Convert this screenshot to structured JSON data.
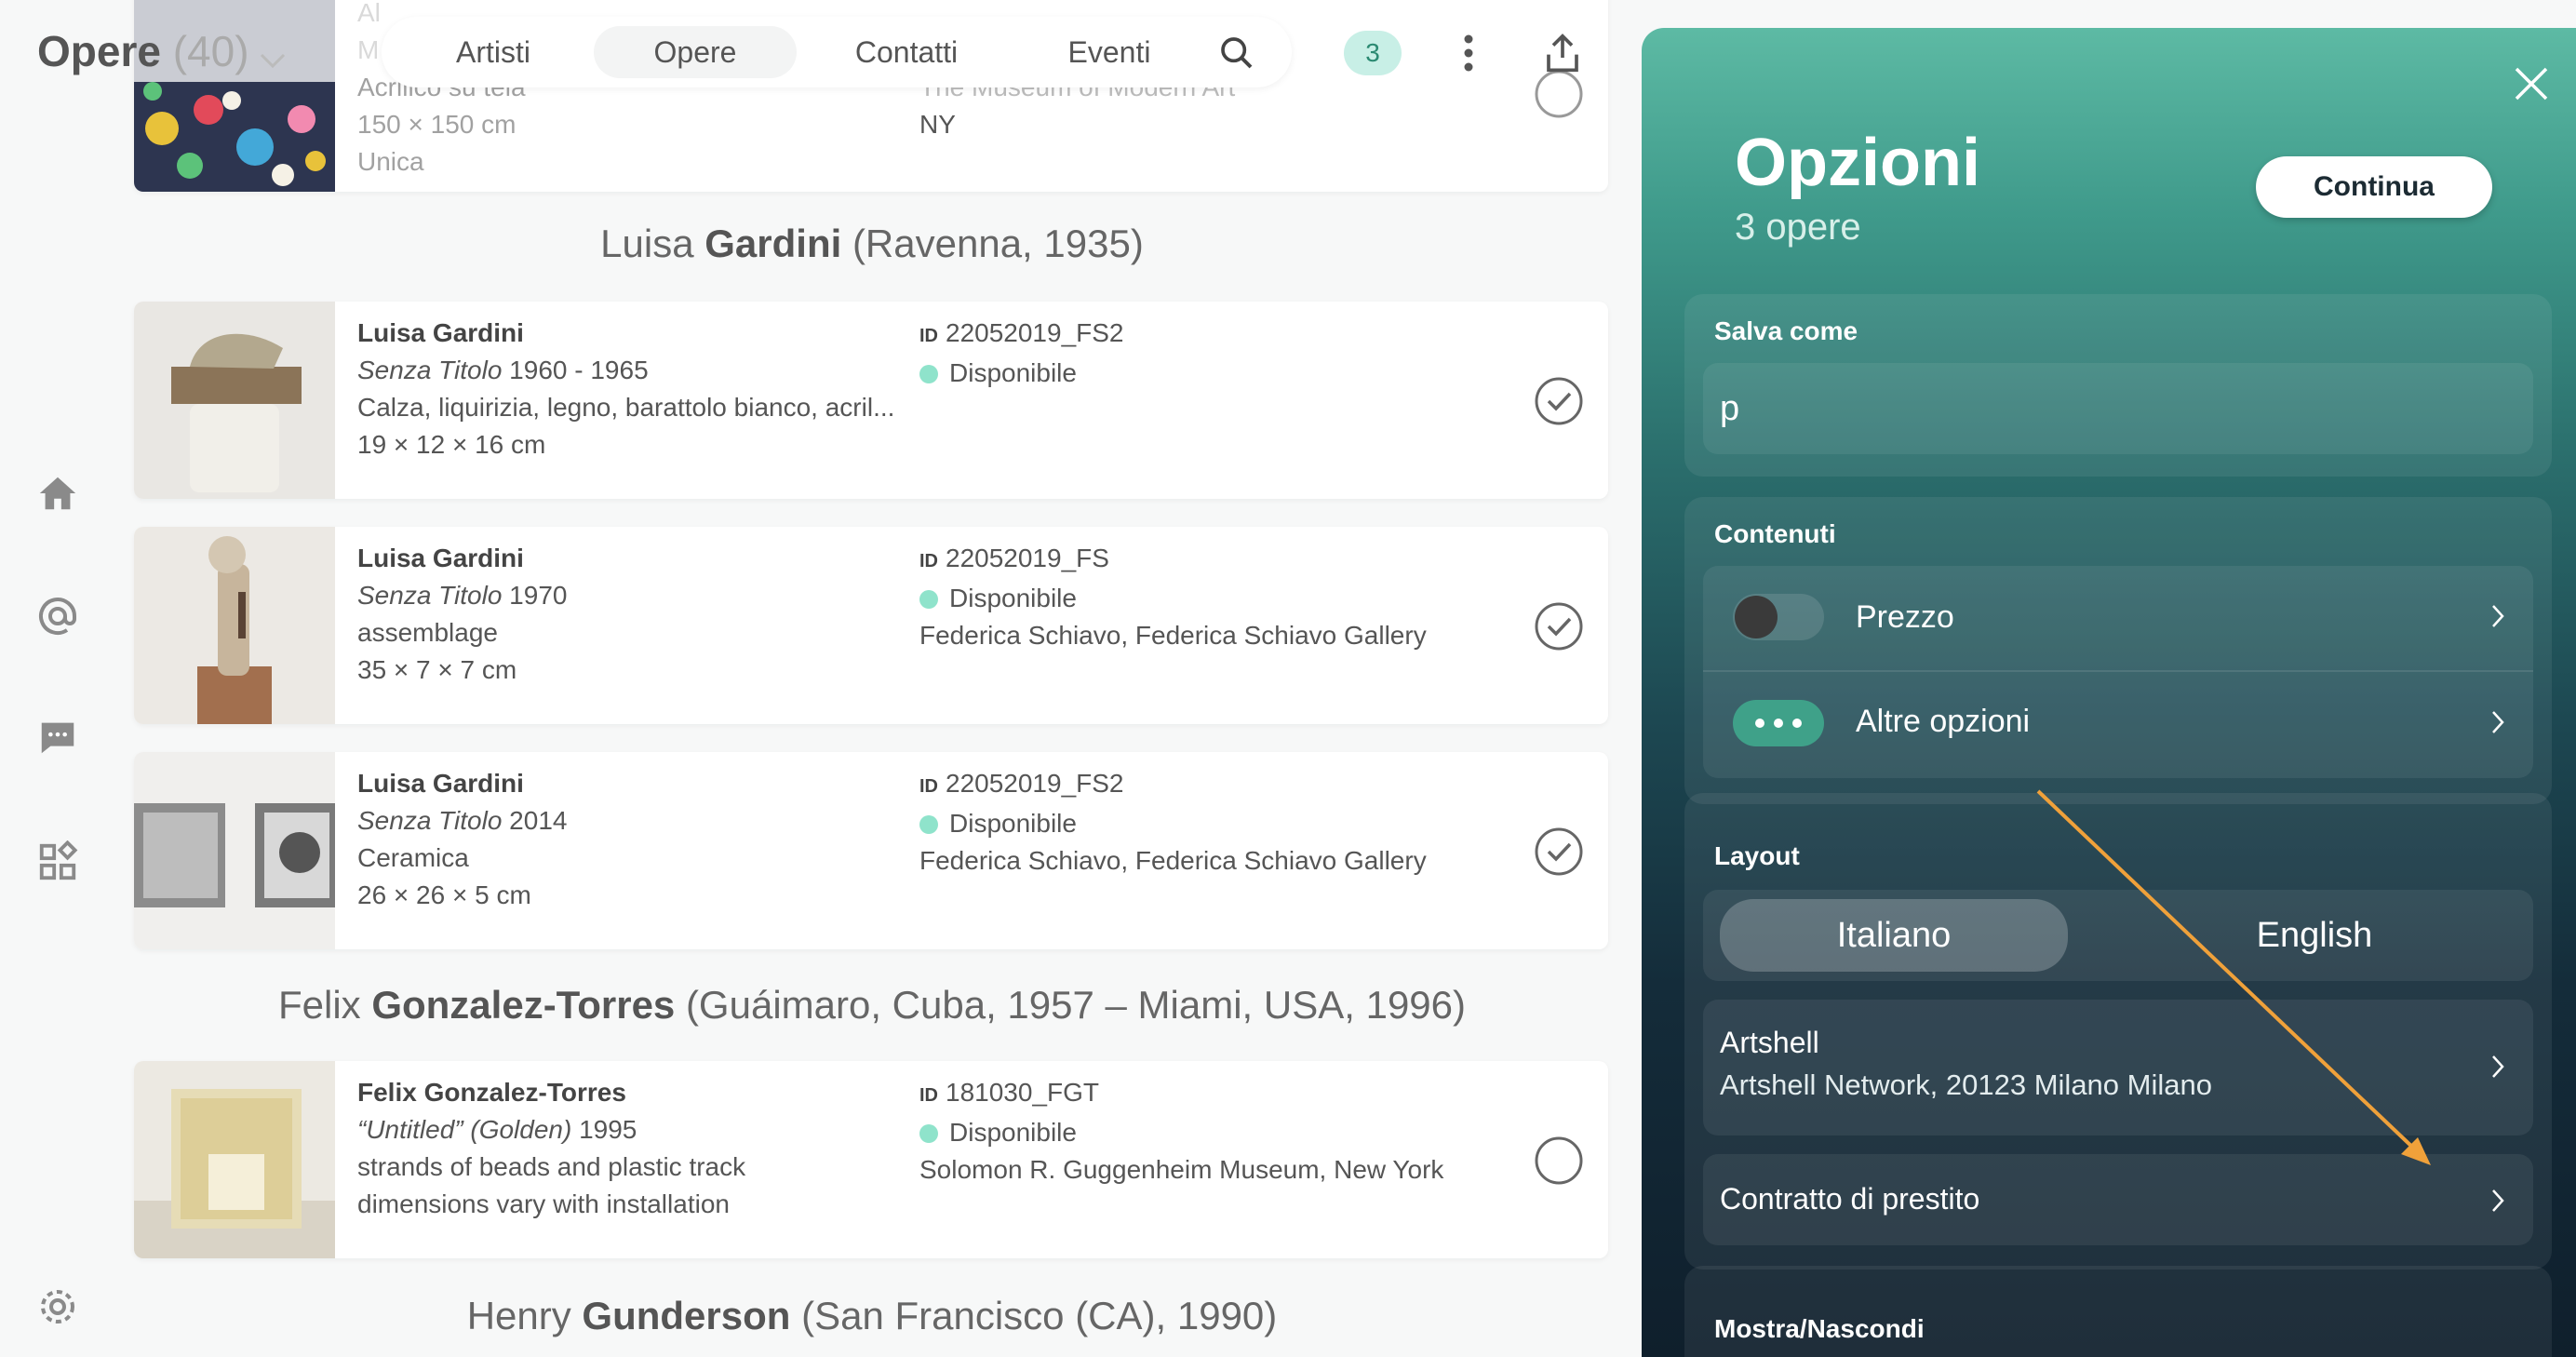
{
  "header": {
    "title": "Opere",
    "count": "(40)",
    "tabs": [
      "Artisti",
      "Opere",
      "Contatti",
      "Eventi"
    ],
    "active_tab": "Opere",
    "selected_count": "3"
  },
  "partial_top": {
    "lines": [
      "Al",
      "M",
      "Acrilico su tela",
      "150 × 150 cm",
      "Unica"
    ],
    "right_lines": [
      "The Museum of Modern Art",
      "NY"
    ]
  },
  "groups": [
    {
      "first": "Luisa ",
      "last": "Gardini",
      "extra": " (Ravenna, 1935)",
      "items": [
        {
          "artist": "Luisa Gardini",
          "title": "Senza Titolo",
          "year": " 1960 - 1965",
          "medium": "Calza, liquirizia, legno, barattolo bianco, acril...",
          "dims": "19 × 12 × 16 cm",
          "id_label": "ID",
          "id": "22052019_FS2",
          "status": "Disponibile",
          "location": "",
          "checked": true
        },
        {
          "artist": "Luisa Gardini",
          "title": "Senza Titolo",
          "year": " 1970",
          "medium": "assemblage",
          "dims": "35 × 7 × 7 cm",
          "id_label": "ID",
          "id": "22052019_FS",
          "status": "Disponibile",
          "location": "Federica Schiavo, Federica Schiavo Gallery",
          "checked": true
        },
        {
          "artist": "Luisa Gardini",
          "title": "Senza Titolo",
          "year": " 2014",
          "medium": "Ceramica",
          "dims": "26 × 26 × 5 cm",
          "id_label": "ID",
          "id": "22052019_FS2",
          "status": "Disponibile",
          "location": "Federica Schiavo, Federica Schiavo Gallery",
          "checked": true
        }
      ]
    },
    {
      "first": "Felix ",
      "last": "Gonzalez-Torres",
      "extra": " (Guáimaro, Cuba, 1957 – Miami, USA, 1996)",
      "items": [
        {
          "artist": "Felix Gonzalez-Torres",
          "title": "“Untitled” (Golden)",
          "year": " 1995",
          "medium": "strands of beads and plastic track",
          "dims": "dimensions vary with installation",
          "id_label": "ID",
          "id": "181030_FGT",
          "status": "Disponibile",
          "location": "Solomon R. Guggenheim Museum, New York",
          "checked": false
        }
      ]
    },
    {
      "first": "Henry ",
      "last": "Gunderson",
      "extra": " (San Francisco (CA), 1990)",
      "items": []
    }
  ],
  "panel": {
    "title": "Opzioni",
    "subtitle": "3 opere",
    "continue_label": "Continua",
    "save_as_label": "Salva come",
    "save_as_value": "p",
    "contents_label": "Contenuti",
    "price_label": "Prezzo",
    "price_enabled": false,
    "more_options_label": "Altre opzioni",
    "layout_label": "Layout",
    "languages": [
      "Italiano",
      "English"
    ],
    "selected_language": "Italiano",
    "sender_name": "Artshell",
    "sender_address": "Artshell Network, 20123 Milano Milano",
    "loan_contract_label": "Contratto di prestito",
    "show_hide_label": "Mostra/Nascondi"
  },
  "colors": {
    "accent_green": "#3fa189",
    "status_dot": "#8fe3cb",
    "annotation_arrow": "#f0a13a"
  },
  "icons": [
    "home-icon",
    "at-icon",
    "chat-icon",
    "apps-icon",
    "settings-icon",
    "search-icon",
    "more-vertical-icon",
    "share-icon",
    "close-icon",
    "chevron-right-icon",
    "check-circle-icon"
  ]
}
